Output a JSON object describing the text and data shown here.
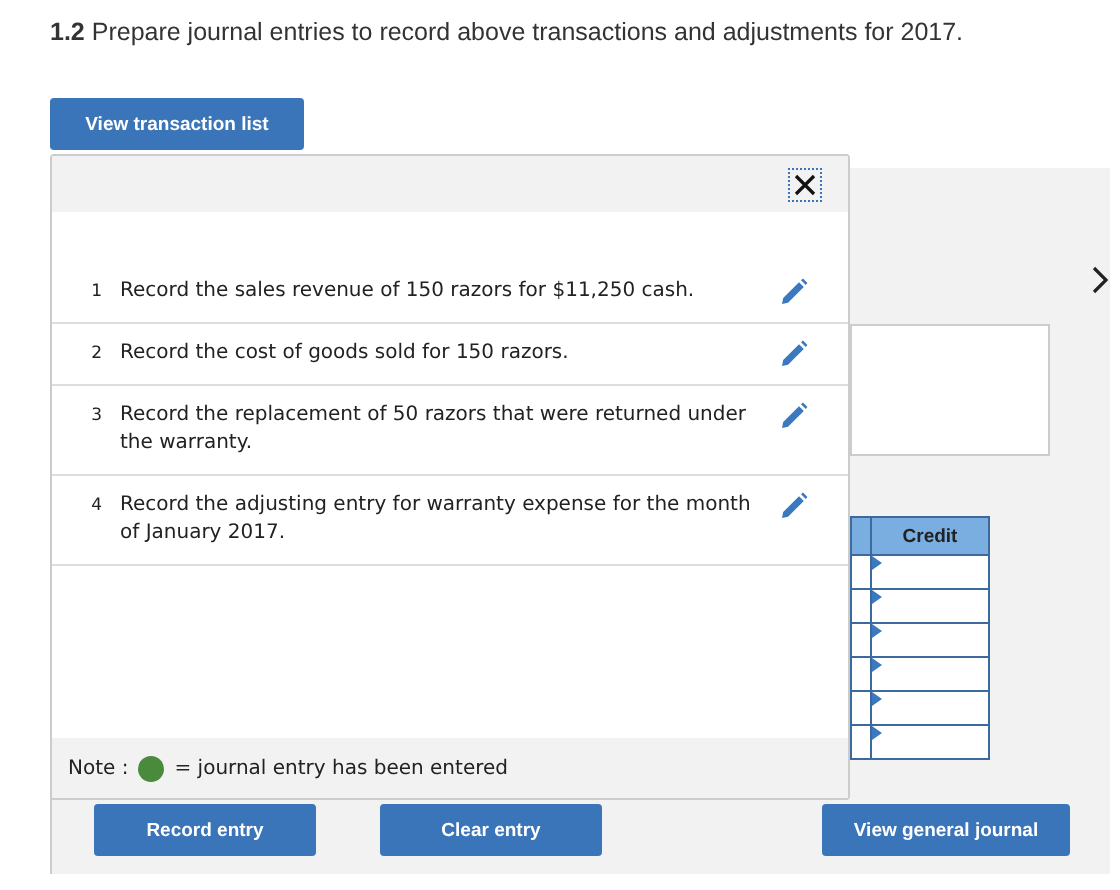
{
  "heading": {
    "number": "1.2",
    "text": "Prepare journal entries to record above transactions and adjustments for 2017."
  },
  "transaction_button": "View transaction list",
  "popup": {
    "items": [
      {
        "number": "1",
        "text": "Record the sales revenue of 150 razors for $11,250 cash."
      },
      {
        "number": "2",
        "text": "Record the cost of goods sold for 150 razors."
      },
      {
        "number": "3",
        "text": "Record the replacement of 50 razors that were returned under the warranty."
      },
      {
        "number": "4",
        "text": "Record the adjusting entry for warranty expense for the month of January 2017."
      }
    ],
    "note": {
      "label": "Note :",
      "text": "= journal entry has been entered",
      "color": "#4a8a3c"
    }
  },
  "journal_table": {
    "columns": [
      {
        "heading": "Credit"
      }
    ]
  },
  "buttons": [
    "Record entry",
    "Clear entry",
    "View general journal"
  ]
}
